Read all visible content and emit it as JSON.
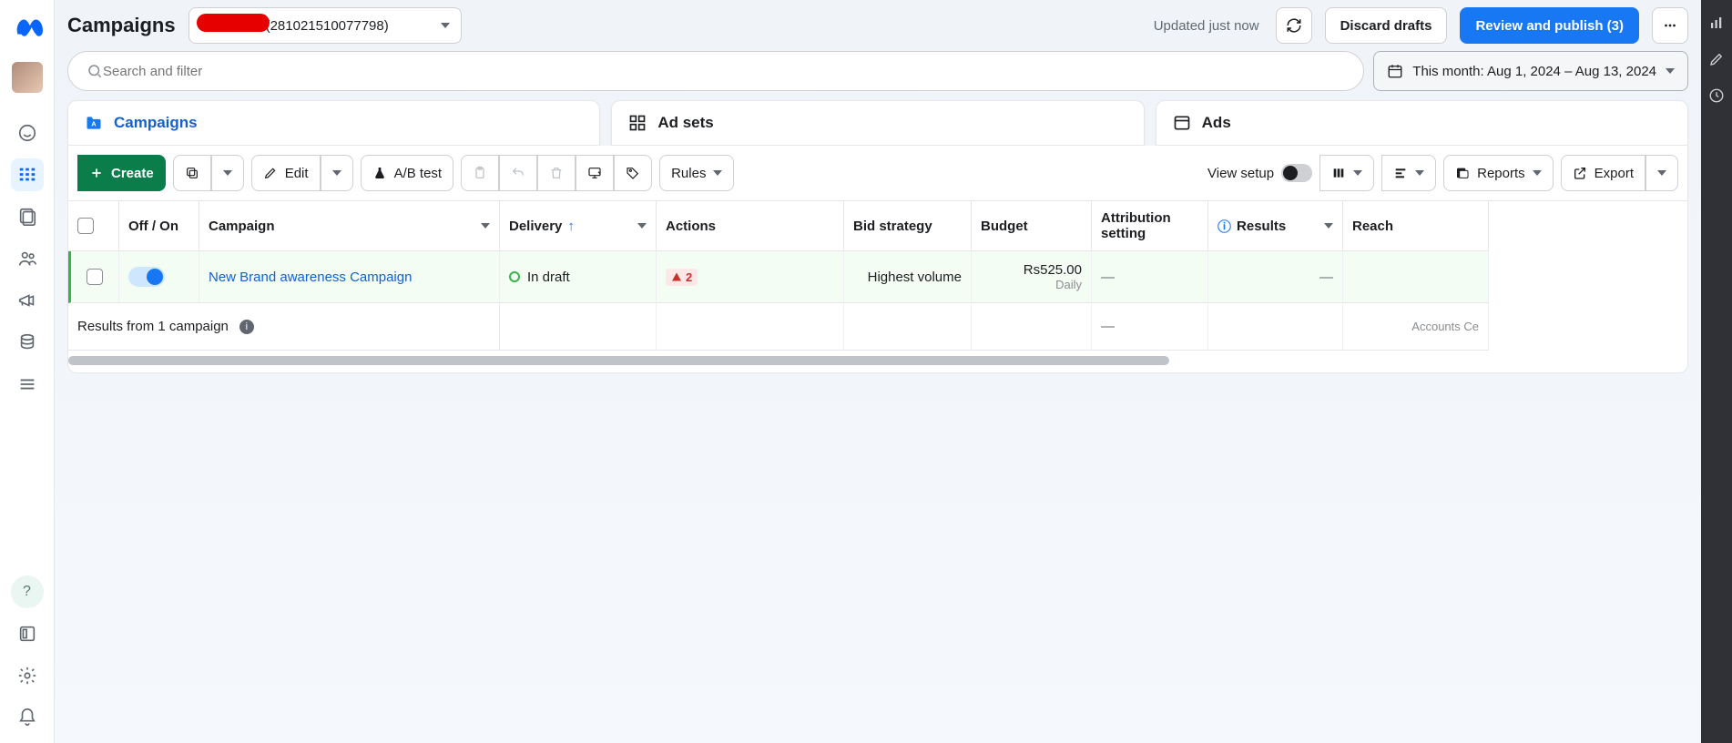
{
  "header": {
    "title": "Campaigns",
    "account_label": "(281021510077798)",
    "updated_text": "Updated just now",
    "discard_label": "Discard drafts",
    "publish_label": "Review and publish (3)"
  },
  "search": {
    "placeholder": "Search and filter",
    "date_label": "This month: Aug 1, 2024 – Aug 13, 2024"
  },
  "tabs": {
    "campaigns": "Campaigns",
    "adsets": "Ad sets",
    "ads": "Ads"
  },
  "toolbar": {
    "create": "Create",
    "edit": "Edit",
    "abtest": "A/B test",
    "rules": "Rules",
    "viewsetup": "View setup",
    "reports": "Reports",
    "export": "Export"
  },
  "columns": {
    "offon": "Off / On",
    "campaign": "Campaign",
    "delivery": "Delivery",
    "actions": "Actions",
    "bid": "Bid strategy",
    "budget": "Budget",
    "attribution": "Attribution setting",
    "results": "Results",
    "reach": "Reach"
  },
  "row": {
    "name": "New Brand awareness Campaign",
    "delivery": "In draft",
    "warn_count": "2",
    "bid": "Highest volume",
    "budget": "Rs525.00",
    "budget_sub": "Daily",
    "attribution": "—",
    "results": "—"
  },
  "summary": {
    "text": "Results from 1 campaign",
    "attribution": "—",
    "reach_note": "Accounts Ce"
  }
}
